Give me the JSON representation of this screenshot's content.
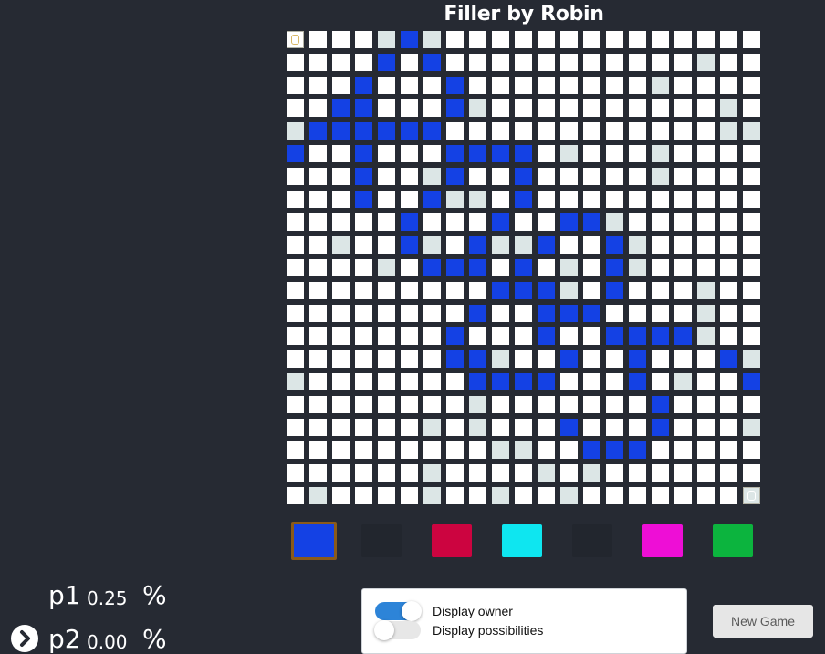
{
  "title": "Filler by Robin",
  "board": {
    "rows": 21,
    "cols": 21,
    "legend": {
      "e": "empty",
      "p": "possible move",
      "o": "owned by player",
      "s1": "player 1 start",
      "s2": "player 2 start"
    },
    "grid": [
      "SeeepopeeeeeeeeeeeeeE",
      "eeeeoeoeeeeeeeeeeepee",
      "eeeoeeeoeeeeeeeepeeee",
      "eeooeeeopeeeeeeeeeepe",
      "pooooooeeeeeeeeeeeepp",
      "oeeoeeeooooepeeepeeee",
      "eeeoeepoeeoeeeeepeeee",
      "eeeoeeoppeoeeeeeeeeee",
      "eeeeeoeeeoeeoopeeeeee",
      "eepeeopeoppoeeopeeeee",
      "eeeepeoooeoepeopeeeee",
      "eeeeeeeeeooopeoeeepee",
      "eeeeeeeeoeeoooeeeepee",
      "eeeeeeeoeeeoeeoooopee",
      "eeeeeeeoopeeoeeoeeeop",
      "peeeeeeeooooeeeoepeeo",
      "eeeeeeeepeeeeeeeoeeee",
      "eeeeeepepeeeoeeeoeeep",
      "eeeeeeeeeppeeoooeeeee",
      "eeeeeepeeeepepeeeeeee",
      "epeeeepeepeepeeeeeeeT"
    ]
  },
  "colors": [
    {
      "name": "blue",
      "hex": "#1441e4",
      "selected": true
    },
    {
      "name": "dark",
      "hex": "#22262e",
      "selected": false
    },
    {
      "name": "crimson",
      "hex": "#cc0440",
      "selected": false
    },
    {
      "name": "cyan",
      "hex": "#0ee6f0",
      "selected": false
    },
    {
      "name": "dark",
      "hex": "#22262e",
      "selected": false
    },
    {
      "name": "magenta",
      "hex": "#ee0ed6",
      "selected": false
    },
    {
      "name": "green",
      "hex": "#0cb43e",
      "selected": false
    }
  ],
  "scores": {
    "p1": {
      "name": "p1",
      "value": "0.25",
      "unit": "%"
    },
    "p2": {
      "name": "p2",
      "value": "0.00",
      "unit": "%",
      "current_turn": true
    }
  },
  "options": {
    "display_owner": {
      "label": "Display owner",
      "on": true
    },
    "display_possibilities": {
      "label": "Display possibilities",
      "on": false
    }
  },
  "new_game_label": "New Game"
}
